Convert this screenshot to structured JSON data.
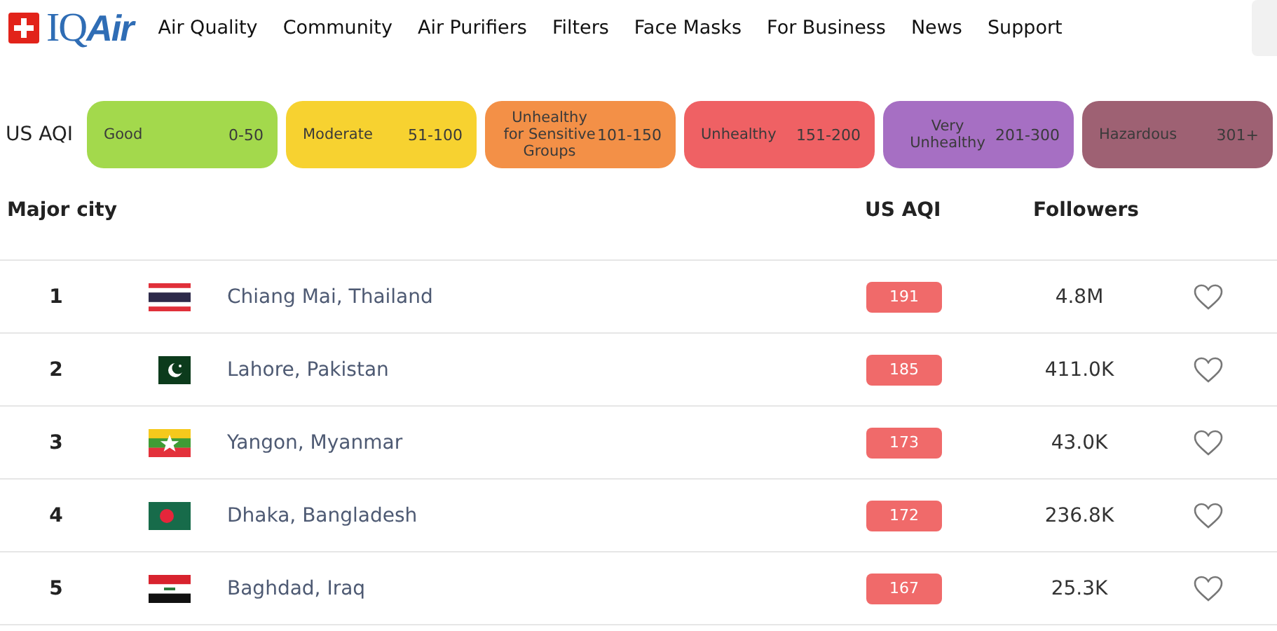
{
  "brand": {
    "name_parts": [
      "IQ",
      "Air"
    ]
  },
  "nav": [
    "Air Quality",
    "Community",
    "Air Purifiers",
    "Filters",
    "Face Masks",
    "For Business",
    "News",
    "Support"
  ],
  "legend": {
    "label": "US AQI",
    "levels": [
      {
        "name": "Good",
        "range": "0-50",
        "color": "#a3d94c"
      },
      {
        "name": "Moderate",
        "range": "51-100",
        "color": "#f7d230"
      },
      {
        "name": "Unhealthy for Sensitive Groups",
        "range": "101-150",
        "color": "#f39047"
      },
      {
        "name": "Unhealthy",
        "range": "151-200",
        "color": "#ef6164"
      },
      {
        "name": "Very Unhealthy",
        "range": "201-300",
        "color": "#a66fc3"
      },
      {
        "name": "Hazardous",
        "range": "301+",
        "color": "#9e6173"
      }
    ]
  },
  "table": {
    "columns": [
      "Major city",
      "US AQI",
      "Followers"
    ],
    "rows": [
      {
        "rank": "1",
        "kind": "thailand",
        "city": "Chiang Mai, Thailand",
        "aqi": "191",
        "color": "#f06a6a",
        "followers": "4.8M",
        "favorite": false
      },
      {
        "rank": "2",
        "kind": "pakistan",
        "city": "Lahore, Pakistan",
        "aqi": "185",
        "color": "#f06a6a",
        "followers": "411.0K",
        "favorite": false
      },
      {
        "rank": "3",
        "kind": "myanmar",
        "city": "Yangon, Myanmar",
        "aqi": "173",
        "color": "#f06a6a",
        "followers": "43.0K",
        "favorite": false
      },
      {
        "rank": "4",
        "kind": "bangladesh",
        "city": "Dhaka, Bangladesh",
        "aqi": "172",
        "color": "#f06a6a",
        "followers": "236.8K",
        "favorite": false
      },
      {
        "rank": "5",
        "kind": "iraq",
        "city": "Baghdad, Iraq",
        "aqi": "167",
        "color": "#f06a6a",
        "followers": "25.3K",
        "favorite": false
      }
    ]
  }
}
